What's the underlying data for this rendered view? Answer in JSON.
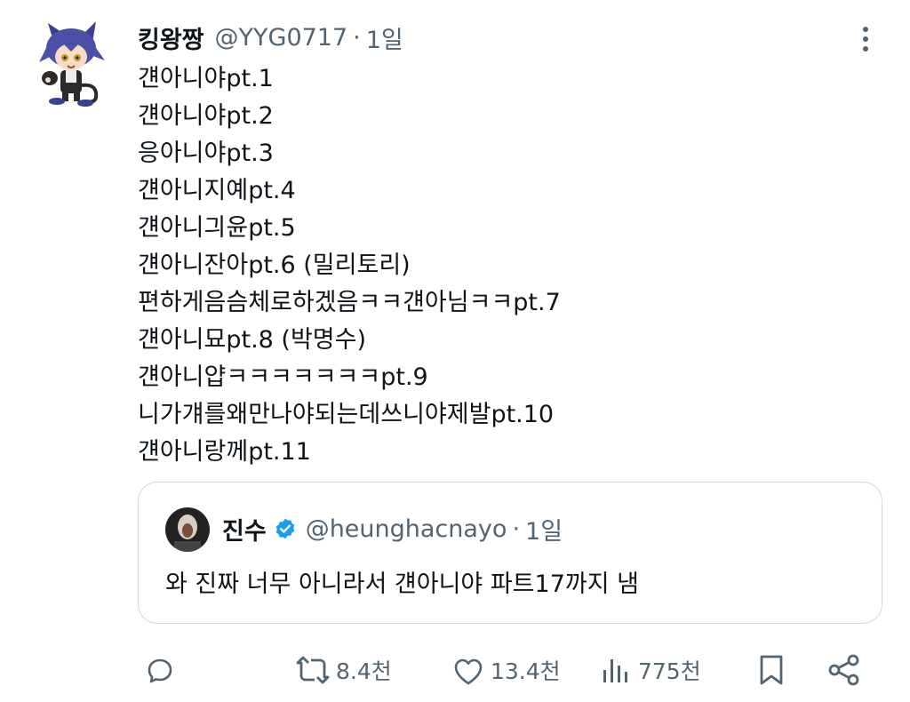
{
  "tweet": {
    "display_name": "킹왕짱",
    "handle": "@YYG0717",
    "separator": "·",
    "time": "1일",
    "lines": [
      "걘아니야pt.1",
      "걘아니야pt.2",
      "응아니야pt.3",
      "걘아니지예pt.4",
      "걘아니긔윤pt.5",
      "걘아니잔아pt.6 (밀리토리)",
      "편하게음슴체로하겠음ㅋㅋ걘아님ㅋㅋpt.7",
      "걘아니묘pt.8 (박명수)",
      "걘아니얍ㅋㅋㅋㅋㅋㅋㅋpt.9",
      "니가걔를왜만나야되는데쓰니야제발pt.10",
      "걘아니랑께pt.11"
    ]
  },
  "quote": {
    "display_name": "진수",
    "handle": "@heunghacnayo",
    "separator": "·",
    "time": "1일",
    "text": "와 진짜 너무 아니라서 걘아니야 파트17까지 냄"
  },
  "actions": {
    "retweet_count": "8.4천",
    "like_count": "13.4천",
    "view_count": "775천"
  },
  "colors": {
    "text": "#0f1419",
    "secondary": "#536471",
    "border": "#cfd9de",
    "verified": "#1d9bf0"
  },
  "icons": [
    "reply-icon",
    "retweet-icon",
    "like-icon",
    "views-icon",
    "bookmark-icon",
    "share-icon",
    "more-icon",
    "verified-badge-icon"
  ]
}
